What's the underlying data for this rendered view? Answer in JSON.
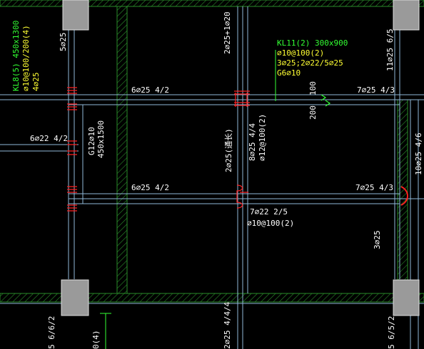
{
  "colors": {
    "background": "#000000",
    "wall_hatch": "#2a8c2a",
    "beam_line": "#8fb8d8",
    "column_fill": "#9a9a9a",
    "rebar_red": "#ff2020",
    "text_white": "#ffffff",
    "text_green": "#33ff33",
    "text_yellow": "#ffff33"
  },
  "labels": {
    "top_left_5": "5⌀25",
    "kl8_title": "KL8(5) 450x1300",
    "kl8_stirrup": "⌀10@100/200(4)",
    "kl8_top": "4⌀25",
    "top_mid_2": "2⌀25+1⌀20",
    "kl11_title": "KL11(2) 300x900",
    "kl11_stirrup": "⌀10@100(2)",
    "kl11_rebar": "3⌀25;2⌀22/5⌀25",
    "kl11_side": "G6⌀10",
    "top_right_11": "11⌀25 6/5",
    "beam_top_left": "6⌀25 4/2",
    "beam_top_right": "7⌀25 4/3",
    "dim_100": "100",
    "dim_200": "200",
    "left_beam": "6⌀22 4/2",
    "g12": "G12⌀10",
    "g12_size": "450x1500",
    "mid_2_25": "2⌀25(通长)",
    "mid_8_25": "8⌀25 4/4",
    "mid_stirrup": "⌀12@100(2)",
    "right_10": "10⌀25 4/6",
    "beam_bot_left": "6⌀25 4/2",
    "beam_bot_right": "7⌀25 4/3",
    "below_7_22": "7⌀22 2/5",
    "below_stirrup": "⌀10@100(2)",
    "right_3_25": "3⌀25",
    "bottom_left_5": "5 6/6/2",
    "bottom_left_0": "0(4)",
    "bottom_mid": "2⌀25 4/4/4",
    "bottom_right": "5 6/5/2"
  }
}
